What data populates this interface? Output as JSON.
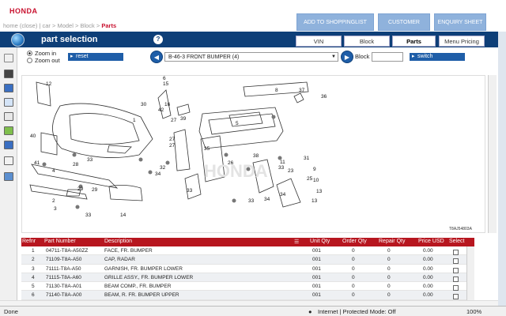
{
  "brand": "HONDA",
  "breadcrumb": {
    "items": [
      "home (close)",
      "car",
      "Model",
      "Block"
    ],
    "current": "Parts"
  },
  "header_buttons": [
    "ADD TO SHOPPINGLIST",
    "CUSTOMER",
    "ENQUIRY SHEET"
  ],
  "panel_title": "part selection",
  "help_glyph": "?",
  "tabs": [
    {
      "label": "VIN"
    },
    {
      "label": "Block"
    },
    {
      "label": "Parts",
      "active": true
    },
    {
      "label": "Menu Pricing"
    }
  ],
  "zoom": {
    "in_label": "Zoom in",
    "out_label": "Zoom out",
    "selected": "Zoom in"
  },
  "reset_label": "reset",
  "block_select_value": "B-46-3 FRONT BUMPER (4)",
  "block_label": "Block",
  "block_input_value": "",
  "switch_label": "switch",
  "diagram": {
    "callouts": [
      "12",
      "1",
      "6",
      "15",
      "30",
      "42",
      "16",
      "5",
      "8",
      "37",
      "36",
      "3",
      "27",
      "39",
      "27",
      "40",
      "27",
      "41",
      "28",
      "33",
      "32",
      "34",
      "33",
      "38",
      "31",
      "4",
      "29",
      "29",
      "35",
      "11",
      "26",
      "33",
      "34",
      "23",
      "9",
      "10",
      "13",
      "25",
      "2",
      "14",
      "33",
      "33",
      "13",
      "34"
    ],
    "code": "T8AJ54803A",
    "watermark": "HONDA"
  },
  "table": {
    "columns": [
      "Refnr",
      "Part Number",
      "Description",
      "Unit Qty",
      "Order Qty",
      "Repair Qty",
      "Price USD",
      "Select"
    ],
    "rows": [
      {
        "ref": "1",
        "part": "04711-T8A-A50ZZ",
        "desc": "FACE, FR. BUMPER",
        "unit": "001",
        "order": "0",
        "repair": "0",
        "price": "0.00"
      },
      {
        "ref": "2",
        "part": "71109-T8A-A50",
        "desc": "CAP, RADAR",
        "unit": "001",
        "order": "0",
        "repair": "0",
        "price": "0.00"
      },
      {
        "ref": "3",
        "part": "71111-T8A-A50",
        "desc": "GARNISH, FR. BUMPER LOWER",
        "unit": "001",
        "order": "0",
        "repair": "0",
        "price": "0.00"
      },
      {
        "ref": "4",
        "part": "71115-T8A-A60",
        "desc": "GRILLE ASSY., FR. BUMPER LOWER",
        "unit": "001",
        "order": "0",
        "repair": "0",
        "price": "0.00"
      },
      {
        "ref": "5",
        "part": "71130-T8A-A01",
        "desc": "BEAM COMP., FR. BUMPER",
        "unit": "001",
        "order": "0",
        "repair": "0",
        "price": "0.00"
      },
      {
        "ref": "6",
        "part": "71140-T8A-A00",
        "desc": "BEAM, R. FR. BUMPER UPPER",
        "unit": "001",
        "order": "0",
        "repair": "0",
        "price": "0.00"
      }
    ]
  },
  "status": {
    "left": "Done",
    "zone": "Internet | Protected Mode: Off",
    "zoom": "100%"
  },
  "colors": {
    "brand_red": "#c8102e",
    "header_blue": "#0e3f78",
    "table_header": "#b7161f",
    "button_blue": "#1f5ea8"
  }
}
